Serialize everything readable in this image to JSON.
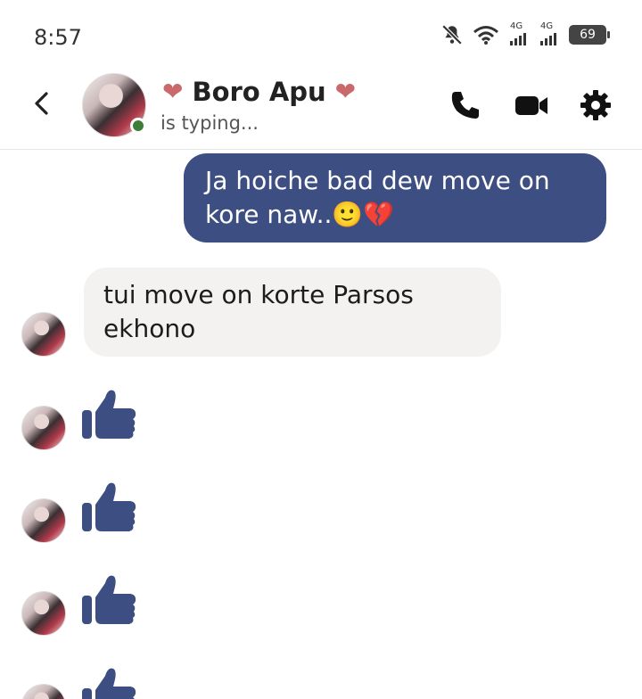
{
  "status_bar": {
    "time": "8:57",
    "network_1": "4G",
    "network_2": "4G",
    "battery": "69",
    "icons": [
      "mute-bell-icon",
      "wifi-icon",
      "signal-icon",
      "signal-icon",
      "battery-icon"
    ]
  },
  "header": {
    "heart_left": "❤",
    "contact_name": "Boro Apu",
    "heart_right": "❤",
    "status": "is typing...",
    "icons": [
      "back-icon",
      "phone-icon",
      "video-icon",
      "gear-icon"
    ]
  },
  "messages": {
    "outgoing_1": "Ja hoiche bad dew move on kore naw..🙂💔",
    "incoming_1": "tui move on korte Parsos ekhono",
    "reactions": [
      "thumbs-up-icon",
      "thumbs-up-icon",
      "thumbs-up-icon",
      "thumbs-up-icon"
    ]
  },
  "colors": {
    "outgoing_bubble": "#3d4e82",
    "incoming_bubble": "#f3f2f0",
    "accent": "#3d4e82",
    "online": "#3f7d3a",
    "heart": "#c9696b"
  }
}
